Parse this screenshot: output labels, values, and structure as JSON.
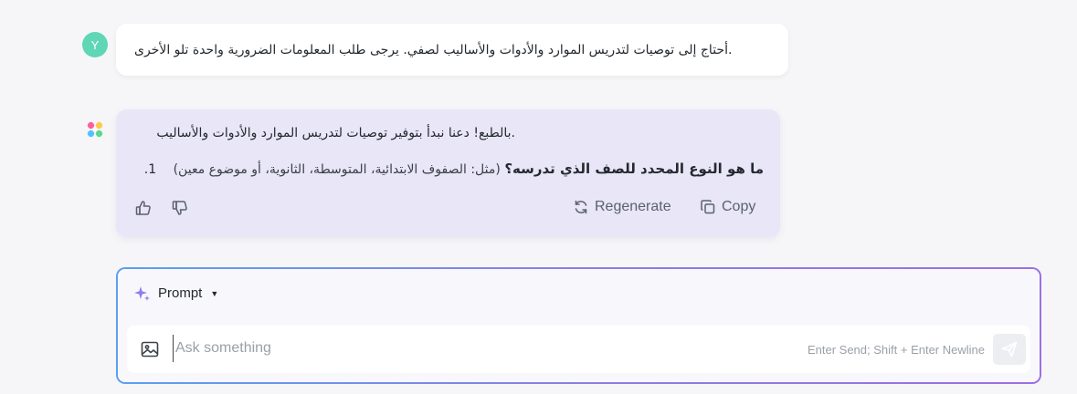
{
  "user_message": {
    "avatar_letter": "Y",
    "avatar_color": "#5fd6b5",
    "text": ".أحتاج إلى توصيات لتدريس الموارد والأدوات والأساليب لصفي. يرجى طلب المعلومات الضرورية واحدة تلو الأخرى"
  },
  "ai_message": {
    "logo_icon": "app-logo-icon",
    "bubble_color": "#e8e6f7",
    "line1": ".بالطبع! دعنا نبدأ بتوفير توصيات لتدريس الموارد والأدوات والأساليب",
    "question_number": "1.",
    "question_bold": "ما هو النوع المحدد للصف الذي تدرسه؟",
    "question_example": "(مثل: الصفوف الابتدائية، المتوسطة، الثانوية، أو موضوع معين)",
    "actions": {
      "like_icon": "thumbs-up-icon",
      "dislike_icon": "thumbs-down-icon",
      "regenerate_label": "Regenerate",
      "regenerate_icon": "refresh-icon",
      "copy_label": "Copy",
      "copy_icon": "copy-icon"
    }
  },
  "composer": {
    "prompt_label": "Prompt",
    "prompt_icon": "sparkle-icon",
    "caret_icon": "caret-down-icon",
    "image_icon": "image-icon",
    "placeholder": "Ask something",
    "hint": "Enter Send; Shift + Enter Newline",
    "send_icon": "send-icon",
    "border_gradient": [
      "#5a9ff2",
      "#9b6fe3"
    ]
  }
}
